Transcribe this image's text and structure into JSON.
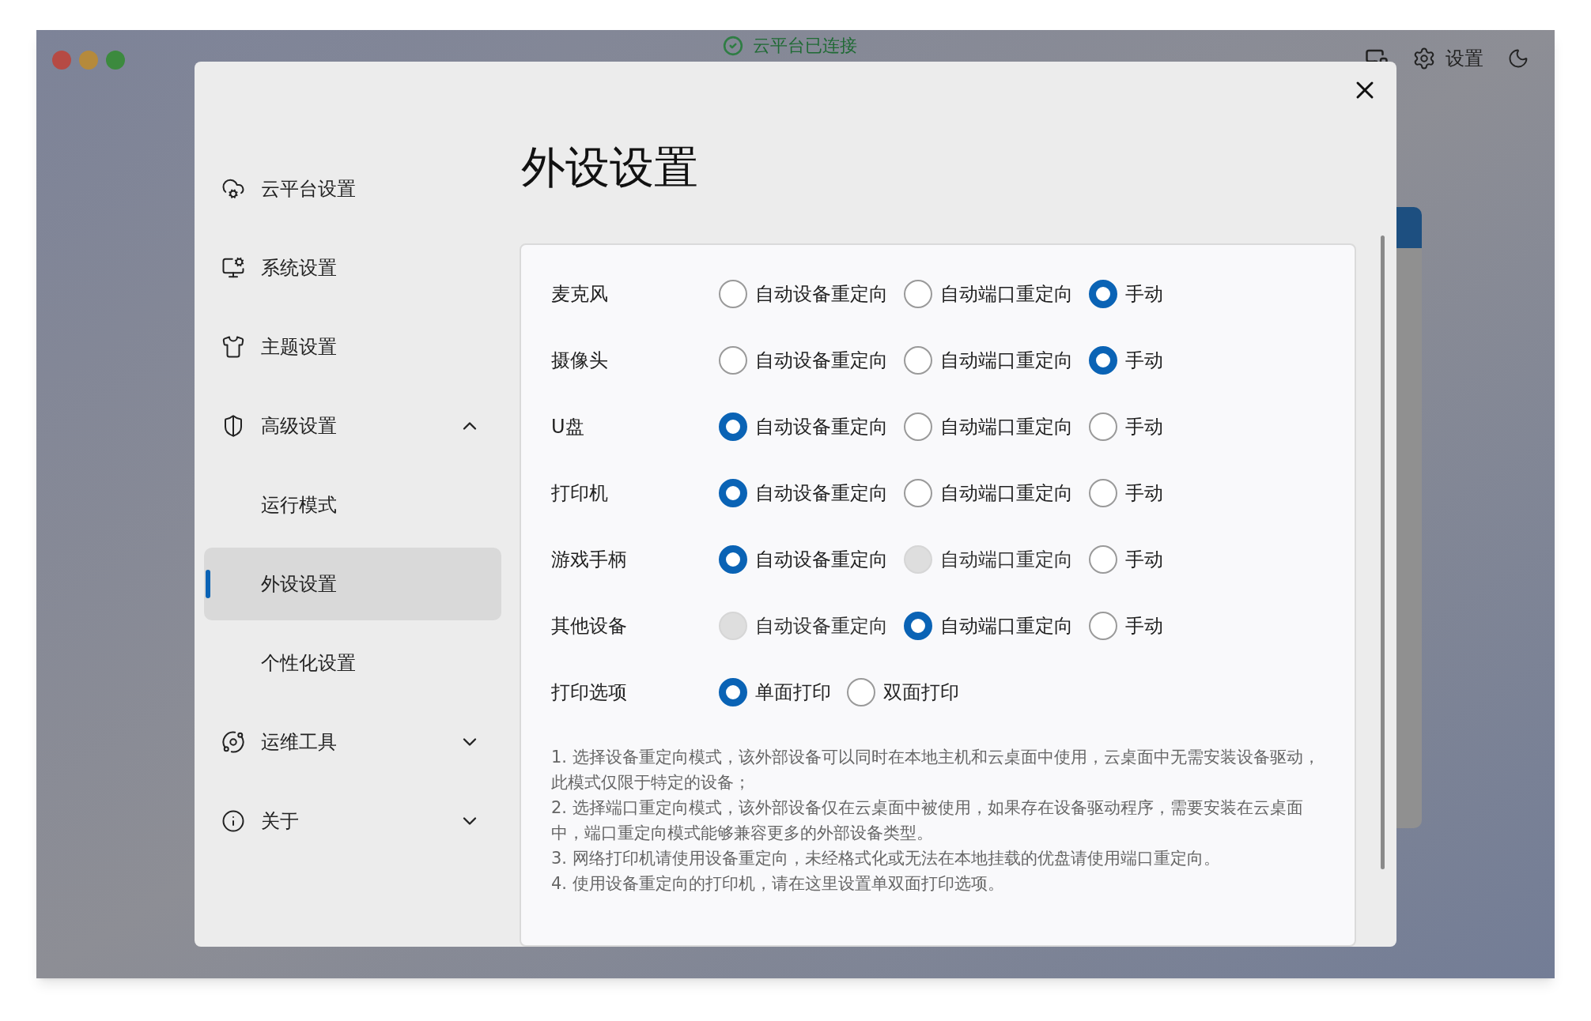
{
  "window": {
    "status": "云平台已连接",
    "header_actions": [
      {
        "label": "设置"
      }
    ]
  },
  "dialog": {
    "title": "外设设置",
    "sidebar": {
      "items": [
        {
          "label": "云平台设置",
          "selected": false
        },
        {
          "label": "系统设置",
          "selected": false
        },
        {
          "label": "主题设置",
          "selected": false
        },
        {
          "label": "高级设置",
          "selected": false,
          "expanded": true,
          "children": [
            {
              "label": "运行模式",
              "selected": false
            },
            {
              "label": "外设设置",
              "selected": true
            },
            {
              "label": "个性化设置",
              "selected": false
            }
          ]
        },
        {
          "label": "运维工具",
          "selected": false,
          "expanded": false
        },
        {
          "label": "关于",
          "selected": false,
          "expanded": false
        }
      ]
    },
    "settings": [
      {
        "label": "麦克风",
        "options": [
          {
            "label": "自动设备重定向",
            "selected": false,
            "disabled": false
          },
          {
            "label": "自动端口重定向",
            "selected": false,
            "disabled": false
          },
          {
            "label": "手动",
            "selected": true,
            "disabled": false
          }
        ]
      },
      {
        "label": "摄像头",
        "options": [
          {
            "label": "自动设备重定向",
            "selected": false,
            "disabled": false
          },
          {
            "label": "自动端口重定向",
            "selected": false,
            "disabled": false
          },
          {
            "label": "手动",
            "selected": true,
            "disabled": false
          }
        ]
      },
      {
        "label": "U盘",
        "options": [
          {
            "label": "自动设备重定向",
            "selected": true,
            "disabled": false
          },
          {
            "label": "自动端口重定向",
            "selected": false,
            "disabled": false
          },
          {
            "label": "手动",
            "selected": false,
            "disabled": false
          }
        ]
      },
      {
        "label": "打印机",
        "options": [
          {
            "label": "自动设备重定向",
            "selected": true,
            "disabled": false
          },
          {
            "label": "自动端口重定向",
            "selected": false,
            "disabled": false
          },
          {
            "label": "手动",
            "selected": false,
            "disabled": false
          }
        ]
      },
      {
        "label": "游戏手柄",
        "options": [
          {
            "label": "自动设备重定向",
            "selected": true,
            "disabled": false
          },
          {
            "label": "自动端口重定向",
            "selected": false,
            "disabled": true
          },
          {
            "label": "手动",
            "selected": false,
            "disabled": false
          }
        ]
      },
      {
        "label": "其他设备",
        "options": [
          {
            "label": "自动设备重定向",
            "selected": false,
            "disabled": true
          },
          {
            "label": "自动端口重定向",
            "selected": true,
            "disabled": false
          },
          {
            "label": "手动",
            "selected": false,
            "disabled": false
          }
        ]
      },
      {
        "label": "打印选项",
        "options": [
          {
            "label": "单面打印",
            "selected": true,
            "disabled": false
          },
          {
            "label": "双面打印",
            "selected": false,
            "disabled": false
          }
        ]
      }
    ],
    "notes": [
      "1. 选择设备重定向模式，该外部设备可以同时在本地主机和云桌面中使用，云桌面中无需安装设备驱动，此模式仅限于特定的设备；",
      "2. 选择端口重定向模式，该外部设备仅在云桌面中被使用，如果存在设备驱动程序，需要安装在云桌面中，端口重定向模式能够兼容更多的外部设备类型。",
      "3. 网络打印机请使用设备重定向，未经格式化或无法在本地挂载的优盘请使用端口重定向。",
      "4. 使用设备重定向的打印机，请在这里设置单双面打印选项。"
    ]
  }
}
